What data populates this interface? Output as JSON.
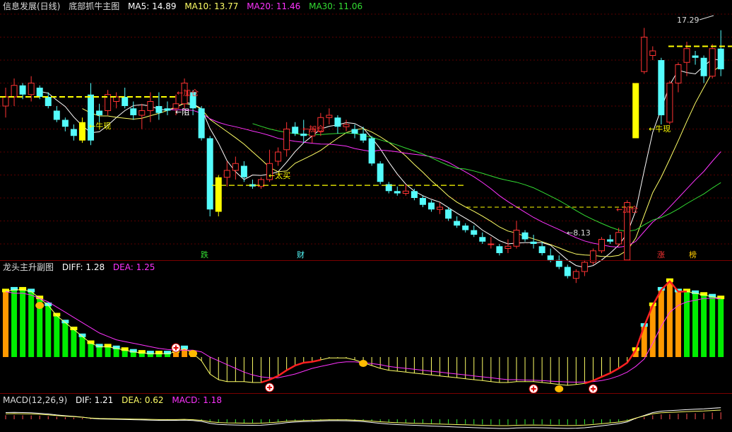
{
  "main_header": {
    "stock": "信息发展(日线)",
    "indicator": "底部抓牛主图",
    "ma": [
      {
        "label": "MA5:",
        "value": "14.89",
        "color": "#ffffff"
      },
      {
        "label": "MA10:",
        "value": "13.77",
        "color": "#ffff66"
      },
      {
        "label": "MA20:",
        "value": "11.46",
        "color": "#ff33ff"
      },
      {
        "label": "MA30:",
        "value": "11.06",
        "color": "#33dd33"
      }
    ]
  },
  "sub1_header": {
    "indicator": "龙头主升副图",
    "diff_label": "DIFF:",
    "diff_value": "1.28",
    "dea_label": "DEA:",
    "dea_value": "1.25"
  },
  "sub2_header": {
    "indicator": "MACD(12,26,9)",
    "dif_label": "DIF:",
    "dif_value": "1.21",
    "dea_label": "DEA:",
    "dea_value": "0.62",
    "macd_label": "MACD:",
    "macd_value": "1.18"
  },
  "colors": {
    "up": "#ff3333",
    "down": "#54fcfc",
    "ma5": "#ffffff",
    "ma10": "#ffff66",
    "ma20": "#ff33ff",
    "ma30": "#33dd33",
    "orange": "#ff9900",
    "green": "#00ee00",
    "yellow": "#ffff00"
  },
  "chart_data": {
    "type": "candlestick",
    "ohlc": [
      [
        14.0,
        14.8,
        13.5,
        14.4
      ],
      [
        14.4,
        15.2,
        14.0,
        14.9
      ],
      [
        14.9,
        15.0,
        14.3,
        14.5
      ],
      [
        14.5,
        15.3,
        14.2,
        15.0
      ],
      [
        14.8,
        14.9,
        14.3,
        14.4
      ],
      [
        14.4,
        14.6,
        13.9,
        14.0
      ],
      [
        13.8,
        14.0,
        13.3,
        13.4
      ],
      [
        13.4,
        13.5,
        12.9,
        13.1
      ],
      [
        13.0,
        13.2,
        12.5,
        12.7
      ],
      [
        13.3,
        13.5,
        12.4,
        12.5
      ],
      [
        14.5,
        15.0,
        12.3,
        12.5
      ],
      [
        13.8,
        14.1,
        13.3,
        13.6
      ],
      [
        13.8,
        14.7,
        13.6,
        14.5
      ],
      [
        14.2,
        14.6,
        13.9,
        14.4
      ],
      [
        14.4,
        14.8,
        13.9,
        14.0
      ],
      [
        13.9,
        14.2,
        13.4,
        13.6
      ],
      [
        13.6,
        14.1,
        13.0,
        13.8
      ],
      [
        13.8,
        14.6,
        13.3,
        14.2
      ],
      [
        14.0,
        14.6,
        13.4,
        13.7
      ],
      [
        13.9,
        14.2,
        13.6,
        13.8
      ],
      [
        13.9,
        14.5,
        13.6,
        14.1
      ],
      [
        14.1,
        15.2,
        13.9,
        15.0
      ],
      [
        14.6,
        14.7,
        13.6,
        13.9
      ],
      [
        13.9,
        14.0,
        12.5,
        12.6
      ],
      [
        12.6,
        12.7,
        9.2,
        9.5
      ],
      [
        9.4,
        11.0,
        9.2,
        10.9
      ],
      [
        10.9,
        11.6,
        10.5,
        11.2
      ],
      [
        11.2,
        11.8,
        10.8,
        11.5
      ],
      [
        11.4,
        11.6,
        10.7,
        10.9
      ],
      [
        10.6,
        10.8,
        10.4,
        10.5
      ],
      [
        10.5,
        10.9,
        10.4,
        10.8
      ],
      [
        10.8,
        12.1,
        10.7,
        11.5
      ],
      [
        11.6,
        12.2,
        11.4,
        12.0
      ],
      [
        12.1,
        13.3,
        11.8,
        13.0
      ],
      [
        13.1,
        13.3,
        12.7,
        12.8
      ],
      [
        12.8,
        13.4,
        12.4,
        12.7
      ],
      [
        12.7,
        13.0,
        12.4,
        13.0
      ],
      [
        12.9,
        13.7,
        12.7,
        13.5
      ],
      [
        13.5,
        13.9,
        13.2,
        13.6
      ],
      [
        13.5,
        13.6,
        12.8,
        13.1
      ],
      [
        13.1,
        13.4,
        12.9,
        13.2
      ],
      [
        13.0,
        13.2,
        12.6,
        12.8
      ],
      [
        12.8,
        13.1,
        12.4,
        12.5
      ],
      [
        12.6,
        12.7,
        11.4,
        11.5
      ],
      [
        11.5,
        11.6,
        10.6,
        10.7
      ],
      [
        10.6,
        10.7,
        10.2,
        10.3
      ],
      [
        10.3,
        10.5,
        10.1,
        10.2
      ],
      [
        10.2,
        10.6,
        10.1,
        10.3
      ],
      [
        10.3,
        10.4,
        9.9,
        10.0
      ],
      [
        10.0,
        10.1,
        9.6,
        9.7
      ],
      [
        9.8,
        9.9,
        9.4,
        9.5
      ],
      [
        9.5,
        9.8,
        9.3,
        9.6
      ],
      [
        9.5,
        9.6,
        9.0,
        9.1
      ],
      [
        9.0,
        9.2,
        8.7,
        8.8
      ],
      [
        8.8,
        8.9,
        8.5,
        8.6
      ],
      [
        8.6,
        8.8,
        8.3,
        8.4
      ],
      [
        8.3,
        8.5,
        8.0,
        8.1
      ],
      [
        8.0,
        8.3,
        7.8,
        8.0
      ],
      [
        7.9,
        8.0,
        7.5,
        7.6
      ],
      [
        7.8,
        8.2,
        7.6,
        7.9
      ],
      [
        7.9,
        9.0,
        7.8,
        8.6
      ],
      [
        8.5,
        8.6,
        8.1,
        8.2
      ],
      [
        8.1,
        8.4,
        7.8,
        8.0
      ],
      [
        7.9,
        8.1,
        7.5,
        7.6
      ],
      [
        7.5,
        7.8,
        7.2,
        7.3
      ],
      [
        7.3,
        7.5,
        6.9,
        7.0
      ],
      [
        7.0,
        7.1,
        6.5,
        6.6
      ],
      [
        6.5,
        6.9,
        6.3,
        6.8
      ],
      [
        6.8,
        7.3,
        6.6,
        7.2
      ],
      [
        7.2,
        7.8,
        7.1,
        7.7
      ],
      [
        7.7,
        8.3,
        7.6,
        8.2
      ],
      [
        8.2,
        8.4,
        8.0,
        8.1
      ],
      [
        8.0,
        8.7,
        7.9,
        8.5
      ],
      [
        7.3,
        9.9,
        7.3,
        9.8
      ],
      [
        15.0,
        15.0,
        12.6,
        12.6
      ],
      [
        15.5,
        17.4,
        15.4,
        17.0
      ],
      [
        16.2,
        16.6,
        16.0,
        16.4
      ],
      [
        16.0,
        16.1,
        13.2,
        13.6
      ],
      [
        13.3,
        15.1,
        13.2,
        15.0
      ],
      [
        15.0,
        15.9,
        14.6,
        15.8
      ],
      [
        15.9,
        16.8,
        15.3,
        16.5
      ],
      [
        16.2,
        16.4,
        15.8,
        16.1
      ],
      [
        16.1,
        16.2,
        15.0,
        15.3
      ],
      [
        15.3,
        16.7,
        15.2,
        16.5
      ],
      [
        16.5,
        17.3,
        15.3,
        15.6
      ]
    ],
    "price_range": [
      8.0,
      18.0
    ],
    "labels": {
      "bull": "←牛现",
      "add": "←加仓",
      "stop": "←阻",
      "taimai": "←太买",
      "high": "17.29",
      "low": "←8.13",
      "bull2": "←牛现"
    },
    "bottom_markers": [
      "跌",
      "财",
      "涨",
      "榜"
    ],
    "sub1": {
      "diff": [
        1.9,
        1.95,
        1.95,
        1.9,
        1.7,
        1.5,
        1.2,
        1.0,
        0.8,
        0.6,
        0.4,
        0.3,
        0.3,
        0.25,
        0.2,
        0.15,
        0.12,
        0.1,
        0.1,
        0.1,
        0.15,
        0.25,
        0.1,
        -0.2,
        -0.9,
        -1.2,
        -1.3,
        -1.3,
        -1.3,
        -1.35,
        -1.35,
        -1.2,
        -1.0,
        -0.7,
        -0.45,
        -0.3,
        -0.25,
        -0.15,
        -0.05,
        -0.05,
        -0.05,
        -0.15,
        -0.3,
        -0.45,
        -0.6,
        -0.7,
        -0.75,
        -0.8,
        -0.85,
        -0.9,
        -0.95,
        -1.0,
        -1.05,
        -1.1,
        -1.15,
        -1.2,
        -1.25,
        -1.3,
        -1.35,
        -1.35,
        -1.3,
        -1.3,
        -1.3,
        -1.35,
        -1.4,
        -1.45,
        -1.5,
        -1.45,
        -1.4,
        -1.25,
        -1.05,
        -0.85,
        -0.6,
        -0.3,
        0.2,
        0.9,
        1.5,
        1.95,
        2.2,
        1.9,
        1.9,
        1.85,
        1.8,
        1.75,
        1.7
      ],
      "dea": [
        1.9,
        1.85,
        1.85,
        1.8,
        1.7,
        1.6,
        1.45,
        1.3,
        1.15,
        1.0,
        0.85,
        0.7,
        0.6,
        0.5,
        0.45,
        0.4,
        0.35,
        0.3,
        0.25,
        0.22,
        0.2,
        0.2,
        0.2,
        0.15,
        0.0,
        -0.2,
        -0.4,
        -0.6,
        -0.8,
        -0.95,
        -1.05,
        -1.1,
        -1.1,
        -1.0,
        -0.9,
        -0.75,
        -0.6,
        -0.5,
        -0.4,
        -0.3,
        -0.25,
        -0.25,
        -0.3,
        -0.35,
        -0.4,
        -0.5,
        -0.55,
        -0.6,
        -0.65,
        -0.7,
        -0.75,
        -0.8,
        -0.85,
        -0.9,
        -0.95,
        -1.0,
        -1.05,
        -1.1,
        -1.15,
        -1.2,
        -1.2,
        -1.22,
        -1.23,
        -1.25,
        -1.28,
        -1.3,
        -1.32,
        -1.33,
        -1.32,
        -1.3,
        -1.25,
        -1.15,
        -1.0,
        -0.8,
        -0.5,
        -0.1,
        0.4,
        0.9,
        1.3,
        1.5,
        1.6,
        1.65,
        1.7,
        1.7,
        1.7
      ],
      "range": [
        -1.8,
        2.4
      ]
    },
    "sub2": {
      "dif": [
        0.7,
        0.72,
        0.7,
        0.68,
        0.62,
        0.55,
        0.45,
        0.37,
        0.3,
        0.22,
        0.1,
        0.04,
        0.02,
        0.0,
        -0.02,
        -0.04,
        -0.06,
        -0.08,
        -0.1,
        -0.1,
        -0.1,
        -0.08,
        -0.12,
        -0.2,
        -0.38,
        -0.48,
        -0.52,
        -0.54,
        -0.56,
        -0.57,
        -0.56,
        -0.5,
        -0.42,
        -0.32,
        -0.26,
        -0.22,
        -0.2,
        -0.16,
        -0.13,
        -0.13,
        -0.14,
        -0.17,
        -0.22,
        -0.3,
        -0.38,
        -0.45,
        -0.5,
        -0.53,
        -0.57,
        -0.6,
        -0.64,
        -0.67,
        -0.7,
        -0.73,
        -0.76,
        -0.79,
        -0.82,
        -0.84,
        -0.87,
        -0.87,
        -0.82,
        -0.8,
        -0.79,
        -0.8,
        -0.82,
        -0.84,
        -0.86,
        -0.84,
        -0.8,
        -0.72,
        -0.62,
        -0.52,
        -0.42,
        -0.25,
        0.1,
        0.4,
        0.7,
        0.85,
        0.9,
        0.95,
        1.0,
        1.05,
        1.08,
        1.15,
        1.21
      ],
      "range": [
        -1.0,
        1.4
      ]
    }
  }
}
